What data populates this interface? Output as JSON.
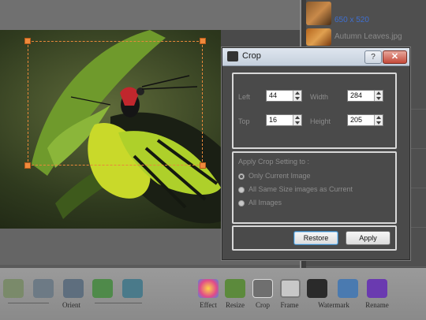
{
  "dialog": {
    "title": "Crop",
    "help_label": "?",
    "close_label": "✕",
    "fields": {
      "left_label": "Left",
      "left_value": "44",
      "top_label": "Top",
      "top_value": "16",
      "width_label": "Width",
      "width_value": "284",
      "height_label": "Height",
      "height_value": "205"
    },
    "apply_title": "Apply Crop Setting to :",
    "options": [
      "Only Current Image",
      "All Same Size images as Current",
      "All Images"
    ],
    "selected_option": "Only Current Image",
    "restore_label": "Restore",
    "apply_label": "Apply"
  },
  "sidebar": {
    "selected_size": "650 x 520",
    "next_file": "Autumn Leaves.jpg"
  },
  "toolbar": {
    "orient_label": "Orient",
    "effect_label": "Effect",
    "resize_label": "Resize",
    "crop_label": "Crop",
    "frame_label": "Frame",
    "watermark_label": "Watermark",
    "rename_label": "Rename"
  },
  "icons": {
    "help": "help-icon",
    "close": "close-icon",
    "dialog": "crop-dialog-icon",
    "effect": "effect-icon",
    "resize": "resize-icon",
    "crop": "crop-icon",
    "frame": "frame-icon",
    "watermark": "camera-icon",
    "text": "text-icon",
    "rename": "rename-icon"
  }
}
